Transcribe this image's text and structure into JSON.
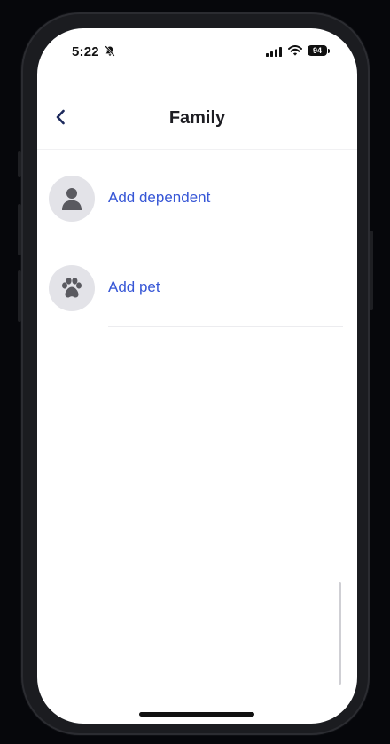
{
  "status_bar": {
    "time": "5:22",
    "battery": "94",
    "icons": [
      "bell-slash-icon",
      "signal-icon",
      "wifi-icon",
      "battery-icon"
    ]
  },
  "nav": {
    "title": "Family",
    "back_icon": "chevron-left-icon"
  },
  "items": [
    {
      "label": "Add dependent",
      "icon": "person-icon"
    },
    {
      "label": "Add pet",
      "icon": "paw-icon"
    }
  ],
  "colors": {
    "accent": "#3656d6",
    "avatar_bg": "#e3e3e8",
    "icon": "#5a5a60",
    "frame": "#1b1c20",
    "background": "#06070b"
  }
}
